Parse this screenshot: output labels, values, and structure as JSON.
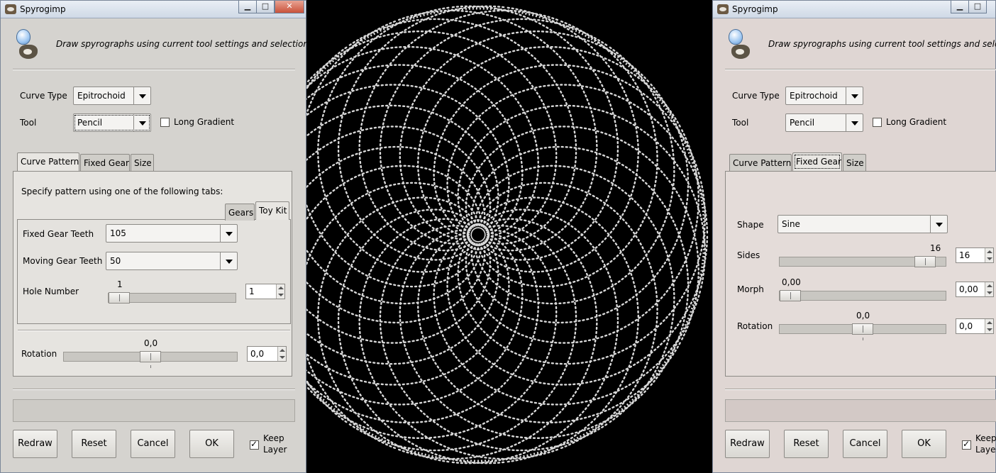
{
  "colors": {
    "canvas_bg": "#000000",
    "curve_stroke": "#d8d8d8",
    "dialog_bg": "#d5d3cf",
    "dialog_bg_right": "#dfd6d3"
  },
  "left_dialog": {
    "title": "Spyrogimp",
    "window_buttons": {
      "minimize": "▁",
      "maximize": "□",
      "close": "✕"
    },
    "description": "Draw spyrographs using current tool settings and selection.",
    "curve_type_label": "Curve Type",
    "curve_type_value": "Epitrochoid",
    "tool_label": "Tool",
    "tool_value": "Pencil",
    "long_gradient_label": "Long Gradient",
    "long_gradient_checked": false,
    "tabs": [
      "Curve Pattern",
      "Fixed Gear",
      "Size"
    ],
    "active_tab": "Curve Pattern",
    "pattern_hint": "Specify pattern using one of the following tabs:",
    "subtabs": [
      "Gears",
      "Toy Kit"
    ],
    "active_subtab": "Toy Kit",
    "fixed_gear_teeth_label": "Fixed Gear Teeth",
    "fixed_gear_teeth_value": "105",
    "moving_gear_teeth_label": "Moving Gear Teeth",
    "moving_gear_teeth_value": "50",
    "hole_number_label": "Hole Number",
    "hole_number_value": "1",
    "hole_number_spin": "1",
    "hole_number_fraction": 0.0,
    "rotation_label": "Rotation",
    "rotation_value": "0,0",
    "rotation_spin": "0,0",
    "rotation_fraction": 0.5,
    "buttons": {
      "redraw": "Redraw",
      "reset": "Reset",
      "cancel": "Cancel",
      "ok": "OK"
    },
    "keep_layer_line1": "Keep",
    "keep_layer_line2": "Layer",
    "keep_layer_checked": true
  },
  "right_dialog": {
    "title": "Spyrogimp",
    "window_buttons": {
      "minimize": "▁",
      "maximize": "□"
    },
    "description": "Draw spyrographs using current tool settings and selecti",
    "curve_type_label": "Curve Type",
    "curve_type_value": "Epitrochoid",
    "tool_label": "Tool",
    "tool_value": "Pencil",
    "long_gradient_label": "Long Gradient",
    "long_gradient_checked": false,
    "tabs": [
      "Curve Pattern",
      "Fixed Gear",
      "Size"
    ],
    "active_tab": "Fixed Gear",
    "shape_label": "Shape",
    "shape_value": "Sine",
    "sides_label": "Sides",
    "sides_value": "16",
    "sides_spin": "16",
    "sides_fraction": 0.93,
    "morph_label": "Morph",
    "morph_value": "0,00",
    "morph_spin": "0,00",
    "morph_fraction": 0.0,
    "rotation_label": "Rotation",
    "rotation_value": "0,0",
    "rotation_spin": "0,0",
    "rotation_fraction": 0.5,
    "buttons": {
      "redraw": "Redraw",
      "reset": "Reset",
      "cancel": "Cancel",
      "ok": "OK"
    },
    "keep_layer_line1": "Keep",
    "keep_layer_line2": "Layer",
    "keep_layer_checked": true
  }
}
